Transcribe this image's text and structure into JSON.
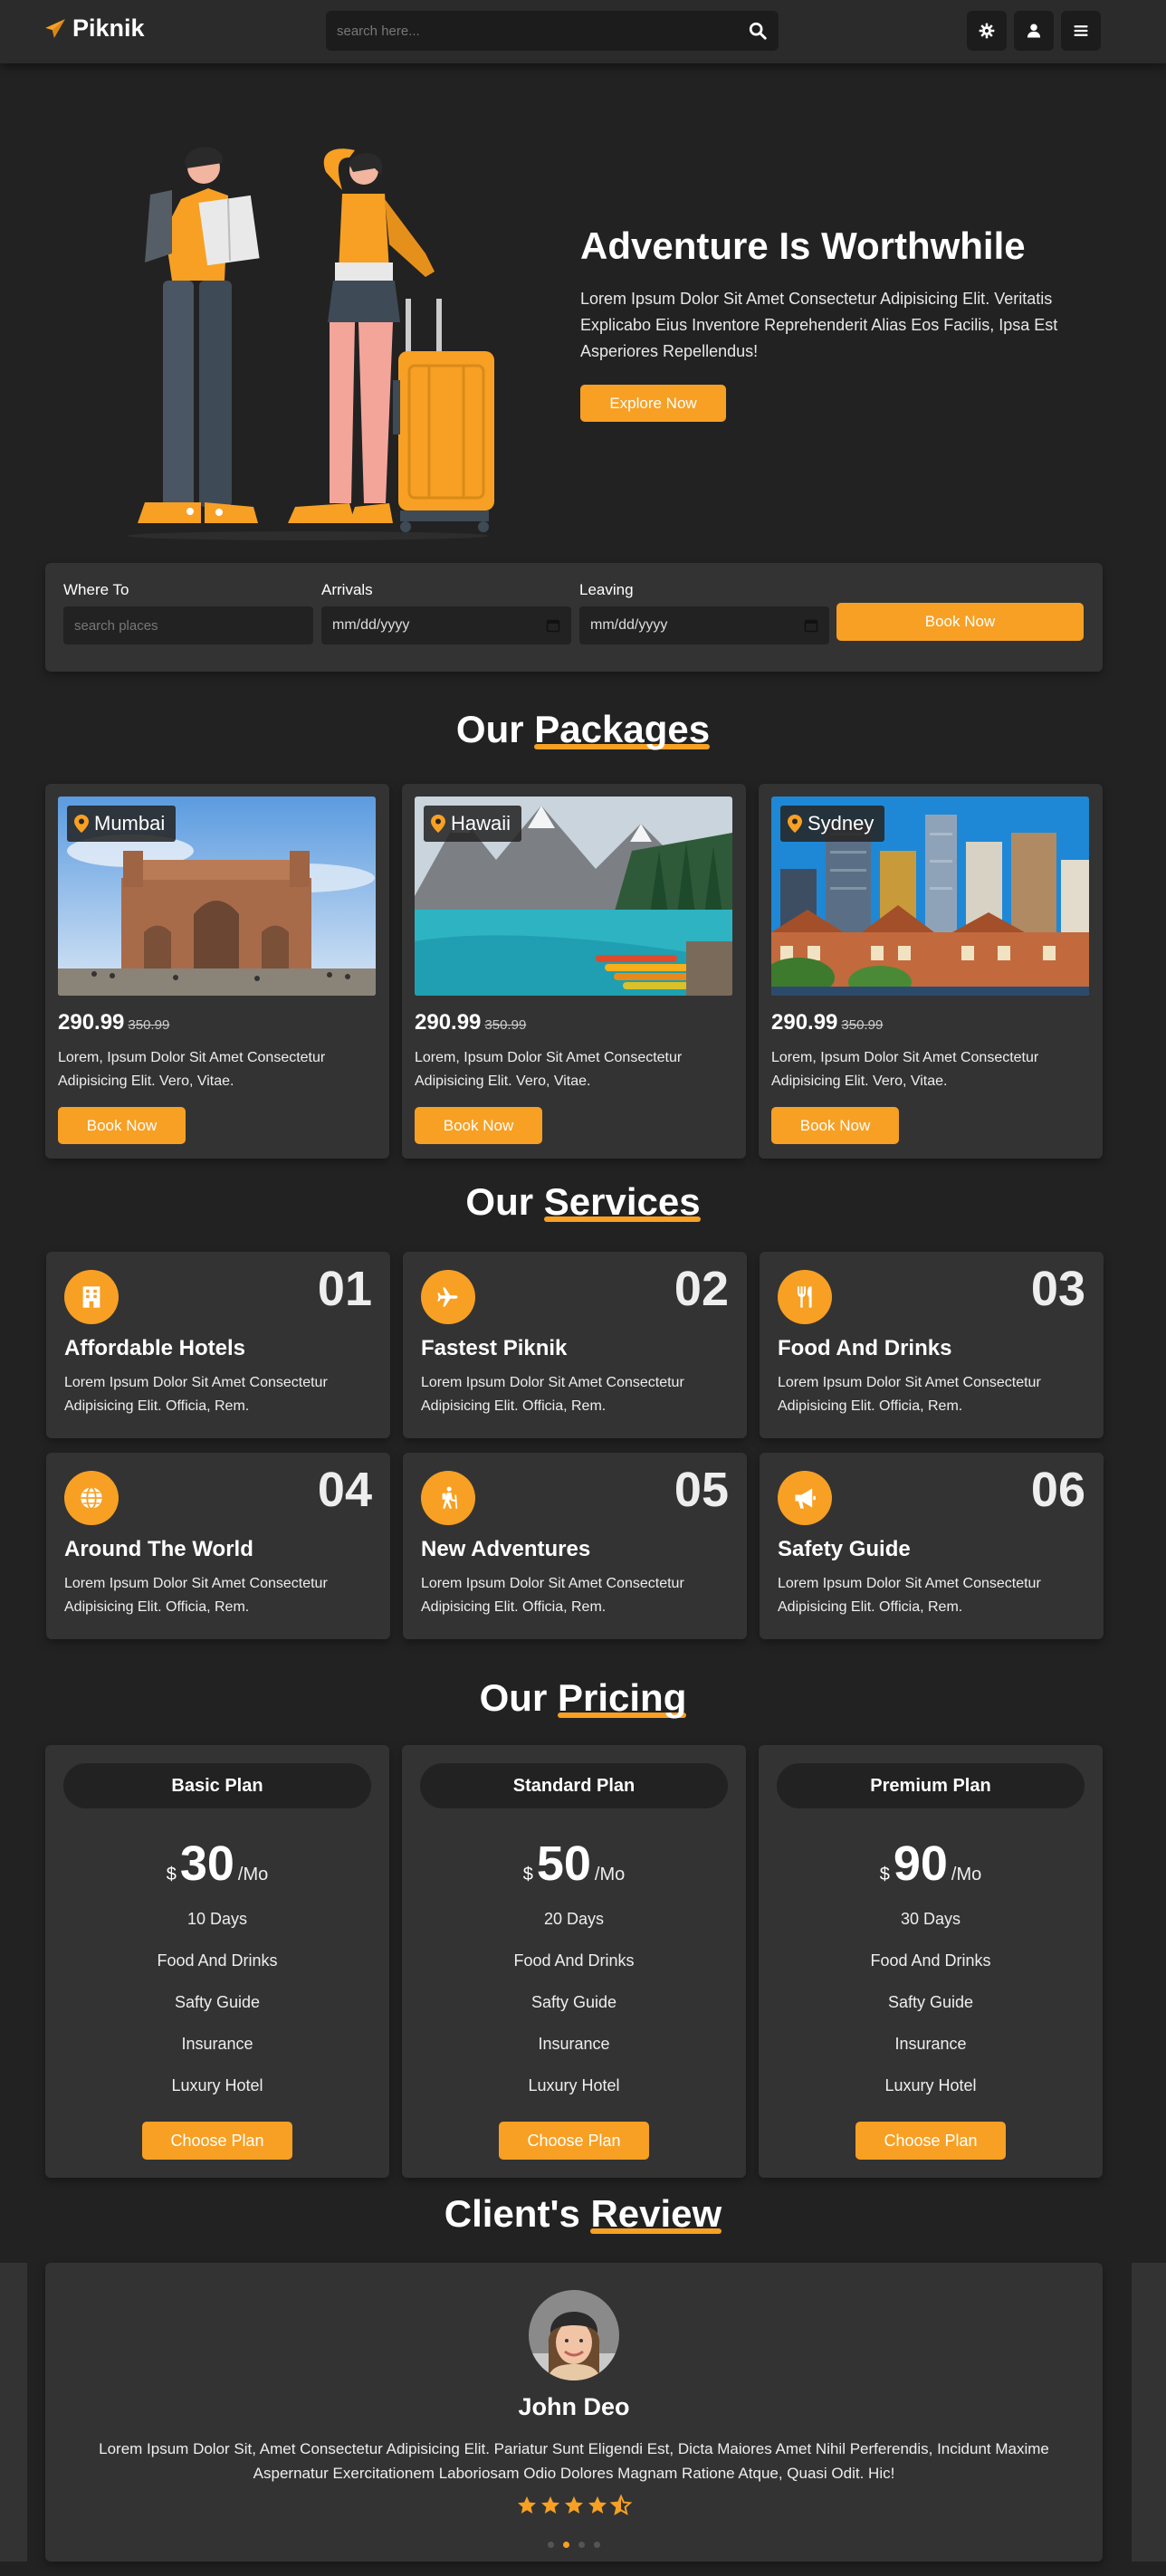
{
  "header": {
    "logo_text": "Piknik",
    "search_placeholder": "search here..."
  },
  "hero": {
    "title": "Adventure Is Worthwhile",
    "description": "Lorem Ipsum Dolor Sit Amet Consectetur Adipisicing Elit. Veritatis Explicabo Eius Inventore Reprehenderit Alias Eos Facilis, Ipsa Est Asperiores Repellendus!",
    "button": "Explore Now"
  },
  "booking": {
    "where_label": "Where To",
    "where_placeholder": "search places",
    "arrivals_label": "Arrivals",
    "arrivals_value": "mm/dd/yyyy",
    "leaving_label": "Leaving",
    "leaving_value": "mm/dd/yyyy",
    "button": "Book Now"
  },
  "packages": {
    "title_plain": "Our ",
    "title_highlight": "Packages",
    "items": [
      {
        "location": "Mumbai",
        "price": "290.99",
        "old_price": "350.99",
        "description": "Lorem, Ipsum Dolor Sit Amet Consectetur Adipisicing Elit. Vero, Vitae.",
        "button": "Book Now"
      },
      {
        "location": "Hawaii",
        "price": "290.99",
        "old_price": "350.99",
        "description": "Lorem, Ipsum Dolor Sit Amet Consectetur Adipisicing Elit. Vero, Vitae.",
        "button": "Book Now"
      },
      {
        "location": "Sydney",
        "price": "290.99",
        "old_price": "350.99",
        "description": "Lorem, Ipsum Dolor Sit Amet Consectetur Adipisicing Elit. Vero, Vitae.",
        "button": "Book Now"
      }
    ]
  },
  "services": {
    "title_plain": "Our ",
    "title_highlight": "Services",
    "items": [
      {
        "number": "01",
        "title": "Affordable Hotels",
        "icon": "hotel-icon",
        "text": "Lorem Ipsum Dolor Sit Amet Consectetur Adipisicing Elit. Officia, Rem."
      },
      {
        "number": "02",
        "title": "Fastest Piknik",
        "icon": "plane-icon",
        "text": "Lorem Ipsum Dolor Sit Amet Consectetur Adipisicing Elit. Officia, Rem."
      },
      {
        "number": "03",
        "title": "Food And Drinks",
        "icon": "utensils-icon",
        "text": "Lorem Ipsum Dolor Sit Amet Consectetur Adipisicing Elit. Officia, Rem."
      },
      {
        "number": "04",
        "title": "Around The World",
        "icon": "globe-icon",
        "text": "Lorem Ipsum Dolor Sit Amet Consectetur Adipisicing Elit. Officia, Rem."
      },
      {
        "number": "05",
        "title": "New Adventures",
        "icon": "hiker-icon",
        "text": "Lorem Ipsum Dolor Sit Amet Consectetur Adipisicing Elit. Officia, Rem."
      },
      {
        "number": "06",
        "title": "Safety Guide",
        "icon": "megaphone-icon",
        "text": "Lorem Ipsum Dolor Sit Amet Consectetur Adipisicing Elit. Officia, Rem."
      }
    ]
  },
  "pricing": {
    "title_plain": "Our ",
    "title_highlight": "Pricing",
    "currency": "$",
    "period": "/Mo",
    "plans": [
      {
        "name": "Basic Plan",
        "amount": "30",
        "features": [
          "10 Days",
          "Food And Drinks",
          "Safty Guide",
          "Insurance",
          "Luxury Hotel"
        ],
        "button": "Choose Plan"
      },
      {
        "name": "Standard Plan",
        "amount": "50",
        "features": [
          "20 Days",
          "Food And Drinks",
          "Safty Guide",
          "Insurance",
          "Luxury Hotel"
        ],
        "button": "Choose Plan"
      },
      {
        "name": "Premium Plan",
        "amount": "90",
        "features": [
          "30 Days",
          "Food And Drinks",
          "Safty Guide",
          "Insurance",
          "Luxury Hotel"
        ],
        "button": "Choose Plan"
      }
    ]
  },
  "review": {
    "title_plain": "Client's ",
    "title_highlight": "Review",
    "name": "John Deo",
    "text": "Lorem Ipsum Dolor Sit, Amet Consectetur Adipisicing Elit. Pariatur Sunt Eligendi Est, Dicta Maiores Amet Nihil Perferendis, Incidunt Maxime Aspernatur Exercitationem Laboriosam Odio Dolores Magnam Ratione Atque, Quasi Odit. Hic!",
    "rating": 4.5,
    "slide_count": 4,
    "active_slide": 2
  },
  "colors": {
    "accent": "#f7a024",
    "background": "#222222",
    "card": "#333333",
    "header": "#2b2b2b"
  }
}
